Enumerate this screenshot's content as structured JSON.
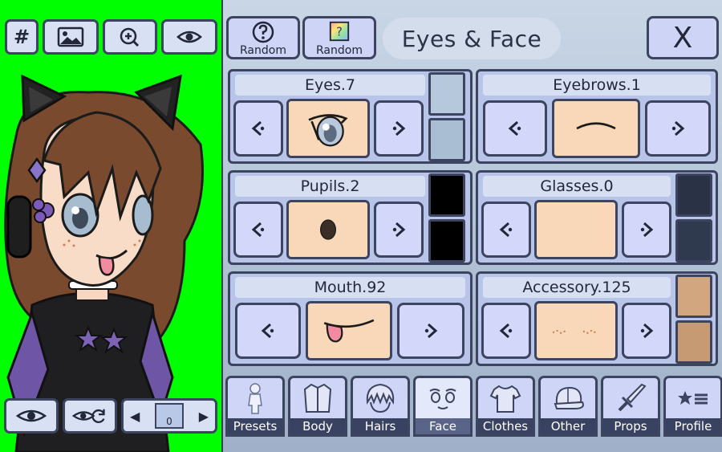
{
  "preview": {
    "toolbar": {
      "hash_label": "#"
    },
    "pose_counter": "0",
    "background_color": "#00ff00"
  },
  "header": {
    "title": "Eyes & Face",
    "random_label_1": "Random",
    "random_label_2": "Random",
    "close_label": "X"
  },
  "parts": {
    "eyes": {
      "label": "Eyes.7"
    },
    "eyebrows": {
      "label": "Eyebrows.1"
    },
    "pupils": {
      "label": "Pupils.2"
    },
    "glasses": {
      "label": "Glasses.0"
    },
    "mouth": {
      "label": "Mouth.92"
    },
    "accessory": {
      "label": "Accessory.125"
    }
  },
  "swatches": {
    "eyes": [
      "#b6c8dc",
      "#a9bdd3"
    ],
    "pupils": [
      "#000000",
      "#000000"
    ],
    "glasses": [
      "#2a3345",
      "#2f3a4e"
    ],
    "accessory": [
      "#d2a77f",
      "#c69a72"
    ]
  },
  "tabs": [
    {
      "label": "Presets",
      "icon": "person-outline-icon"
    },
    {
      "label": "Body",
      "icon": "jacket-icon"
    },
    {
      "label": "Hairs",
      "icon": "hair-icon"
    },
    {
      "label": "Face",
      "icon": "face-icon"
    },
    {
      "label": "Clothes",
      "icon": "tshirt-icon"
    },
    {
      "label": "Other",
      "icon": "cap-icon"
    },
    {
      "label": "Props",
      "icon": "sword-icon"
    },
    {
      "label": "Profile",
      "icon": "star-list-icon"
    }
  ],
  "active_tab": "Face"
}
